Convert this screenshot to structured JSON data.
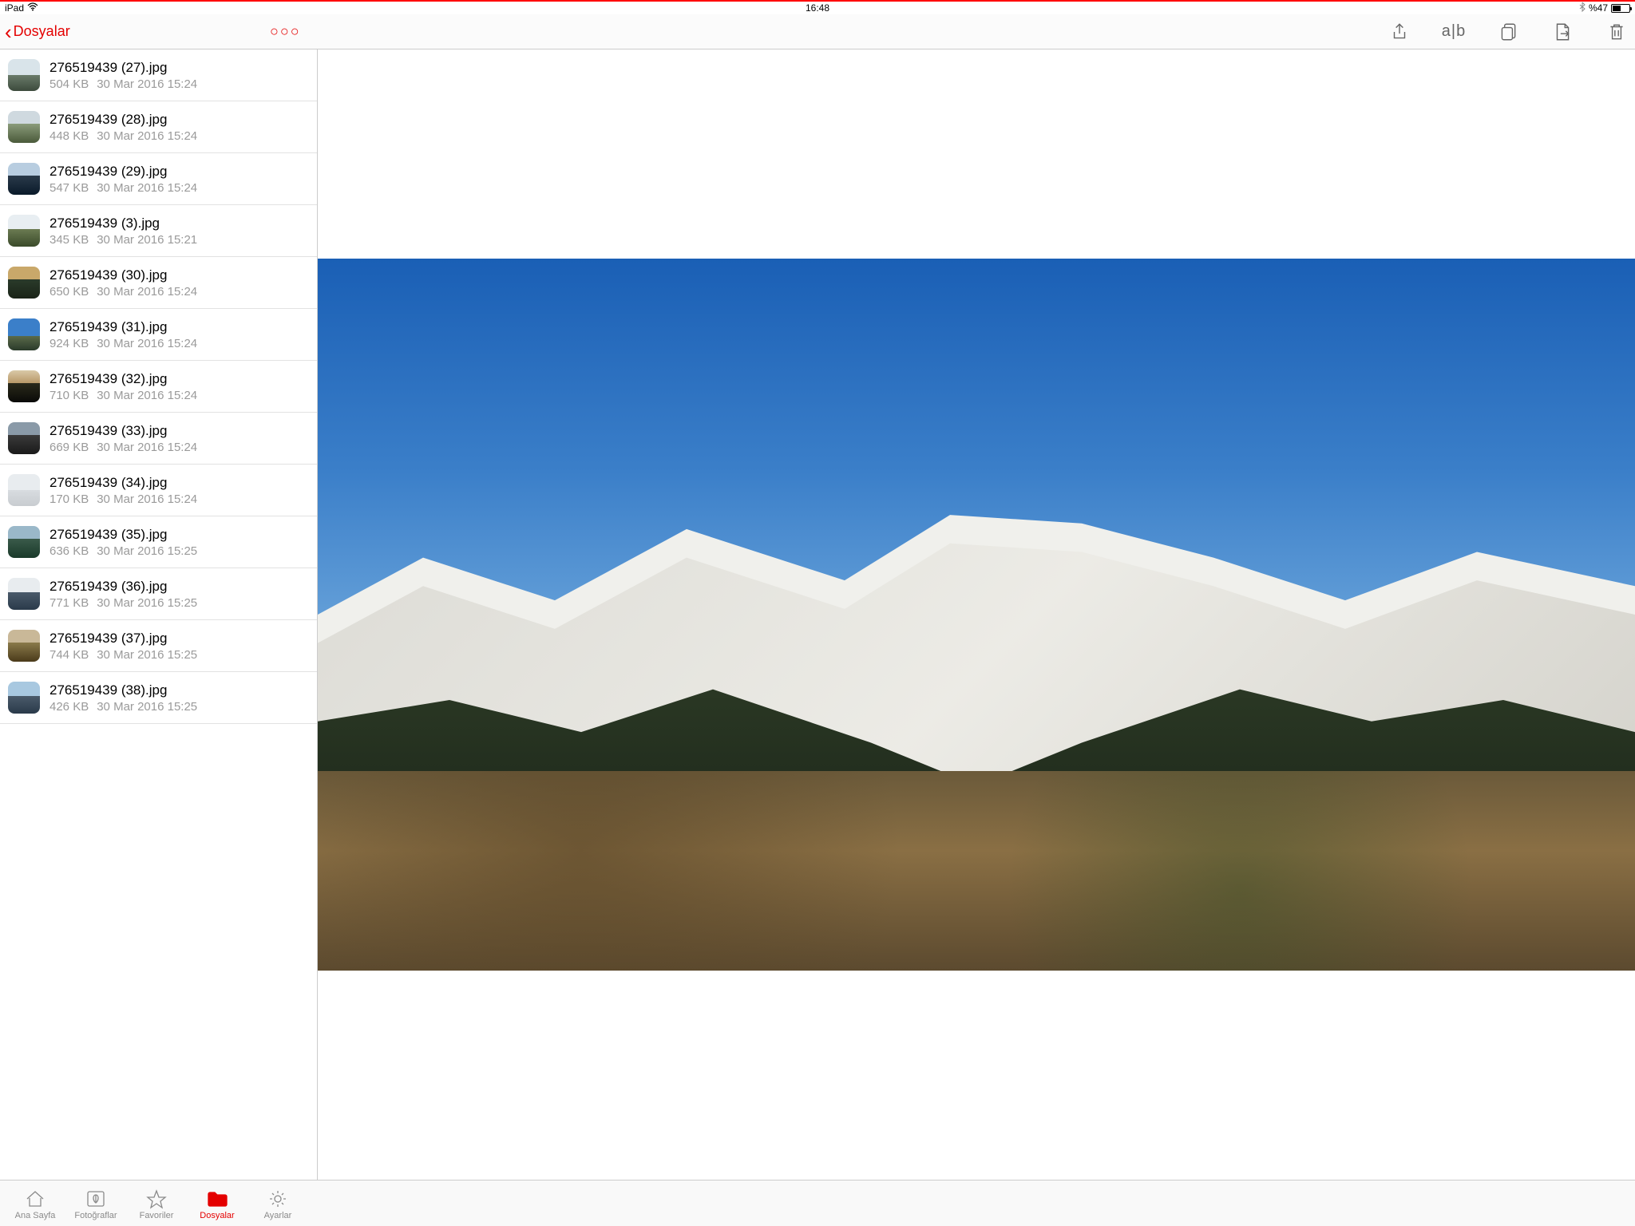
{
  "status": {
    "device": "iPad",
    "time": "16:48",
    "battery": "%47"
  },
  "nav": {
    "back_label": "Dosyalar",
    "ab_label": "a|b"
  },
  "files": [
    {
      "name": "276519439 (27).jpg",
      "size": "504 KB",
      "date": "30 Mar 2016 15:24"
    },
    {
      "name": "276519439 (28).jpg",
      "size": "448 KB",
      "date": "30 Mar 2016 15:24"
    },
    {
      "name": "276519439 (29).jpg",
      "size": "547 KB",
      "date": "30 Mar 2016 15:24"
    },
    {
      "name": "276519439 (3).jpg",
      "size": "345 KB",
      "date": "30 Mar 2016 15:21"
    },
    {
      "name": "276519439 (30).jpg",
      "size": "650 KB",
      "date": "30 Mar 2016 15:24"
    },
    {
      "name": "276519439 (31).jpg",
      "size": "924 KB",
      "date": "30 Mar 2016 15:24"
    },
    {
      "name": "276519439 (32).jpg",
      "size": "710 KB",
      "date": "30 Mar 2016 15:24"
    },
    {
      "name": "276519439 (33).jpg",
      "size": "669 KB",
      "date": "30 Mar 2016 15:24"
    },
    {
      "name": "276519439 (34).jpg",
      "size": "170 KB",
      "date": "30 Mar 2016 15:24"
    },
    {
      "name": "276519439 (35).jpg",
      "size": "636 KB",
      "date": "30 Mar 2016 15:25"
    },
    {
      "name": "276519439 (36).jpg",
      "size": "771 KB",
      "date": "30 Mar 2016 15:25"
    },
    {
      "name": "276519439 (37).jpg",
      "size": "744 KB",
      "date": "30 Mar 2016 15:25"
    },
    {
      "name": "276519439 (38).jpg",
      "size": "426 KB",
      "date": "30 Mar 2016 15:25"
    }
  ],
  "tabs": {
    "home": "Ana Sayfa",
    "photos": "Fotoğraflar",
    "favorites": "Favoriler",
    "files": "Dosyalar",
    "settings": "Ayarlar"
  }
}
